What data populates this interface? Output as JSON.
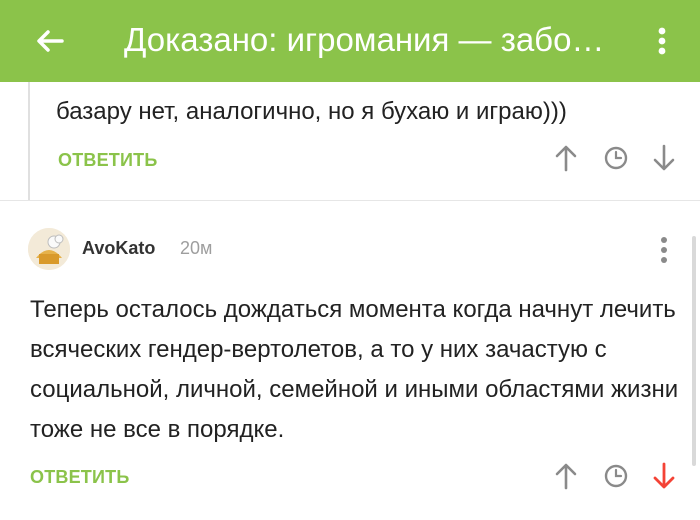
{
  "header": {
    "title": "Доказано: игромания — забо…",
    "back_icon": "arrow-left-icon",
    "menu_icon": "more-vertical-icon",
    "background": "#8bc34a"
  },
  "comments": [
    {
      "text": "базару нет, аналогично, но я бухаю и играю)))",
      "reply_label": "ОТВЕТИТЬ",
      "actions": [
        "arrow-up-icon",
        "clock-icon",
        "arrow-down-icon"
      ]
    },
    {
      "author": "AvoKato",
      "time": "20м",
      "text": "Теперь осталось дождаться момента когда начнут лечить всяческих гендер-вертолетов, а то у них зачастую с социальной, личной, семейной и иными областями жизни тоже не все в порядке.",
      "reply_label": "ОТВЕТИТЬ",
      "actions": [
        "arrow-up-icon",
        "clock-icon",
        "arrow-down-icon"
      ],
      "downvote_active_color": "#f44336"
    }
  ],
  "colors": {
    "accent": "#8bc34a",
    "icon_gray": "#8a8a8a",
    "downvote": "#f44336"
  }
}
